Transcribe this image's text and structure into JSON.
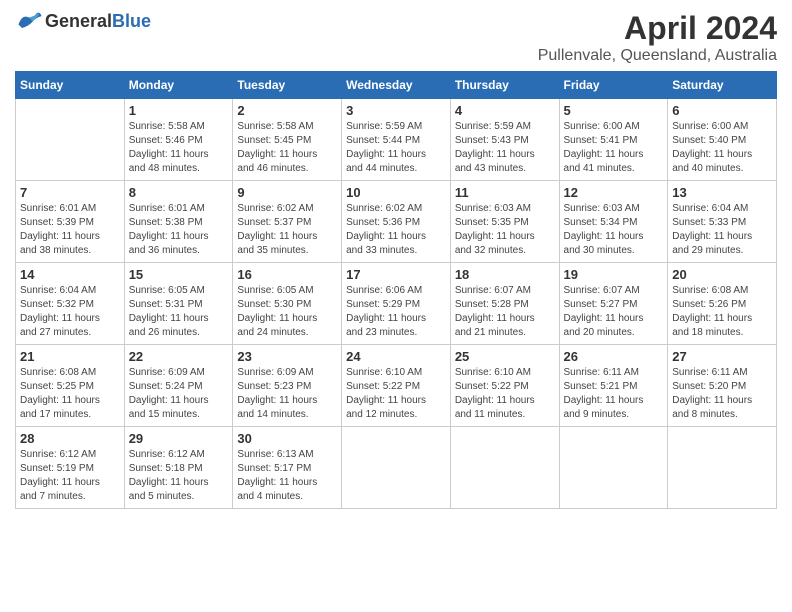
{
  "logo": {
    "general": "General",
    "blue": "Blue"
  },
  "title": "April 2024",
  "location": "Pullenvale, Queensland, Australia",
  "days_of_week": [
    "Sunday",
    "Monday",
    "Tuesday",
    "Wednesday",
    "Thursday",
    "Friday",
    "Saturday"
  ],
  "weeks": [
    [
      {
        "day": "",
        "info": ""
      },
      {
        "day": "1",
        "info": "Sunrise: 5:58 AM\nSunset: 5:46 PM\nDaylight: 11 hours\nand 48 minutes."
      },
      {
        "day": "2",
        "info": "Sunrise: 5:58 AM\nSunset: 5:45 PM\nDaylight: 11 hours\nand 46 minutes."
      },
      {
        "day": "3",
        "info": "Sunrise: 5:59 AM\nSunset: 5:44 PM\nDaylight: 11 hours\nand 44 minutes."
      },
      {
        "day": "4",
        "info": "Sunrise: 5:59 AM\nSunset: 5:43 PM\nDaylight: 11 hours\nand 43 minutes."
      },
      {
        "day": "5",
        "info": "Sunrise: 6:00 AM\nSunset: 5:41 PM\nDaylight: 11 hours\nand 41 minutes."
      },
      {
        "day": "6",
        "info": "Sunrise: 6:00 AM\nSunset: 5:40 PM\nDaylight: 11 hours\nand 40 minutes."
      }
    ],
    [
      {
        "day": "7",
        "info": "Sunrise: 6:01 AM\nSunset: 5:39 PM\nDaylight: 11 hours\nand 38 minutes."
      },
      {
        "day": "8",
        "info": "Sunrise: 6:01 AM\nSunset: 5:38 PM\nDaylight: 11 hours\nand 36 minutes."
      },
      {
        "day": "9",
        "info": "Sunrise: 6:02 AM\nSunset: 5:37 PM\nDaylight: 11 hours\nand 35 minutes."
      },
      {
        "day": "10",
        "info": "Sunrise: 6:02 AM\nSunset: 5:36 PM\nDaylight: 11 hours\nand 33 minutes."
      },
      {
        "day": "11",
        "info": "Sunrise: 6:03 AM\nSunset: 5:35 PM\nDaylight: 11 hours\nand 32 minutes."
      },
      {
        "day": "12",
        "info": "Sunrise: 6:03 AM\nSunset: 5:34 PM\nDaylight: 11 hours\nand 30 minutes."
      },
      {
        "day": "13",
        "info": "Sunrise: 6:04 AM\nSunset: 5:33 PM\nDaylight: 11 hours\nand 29 minutes."
      }
    ],
    [
      {
        "day": "14",
        "info": "Sunrise: 6:04 AM\nSunset: 5:32 PM\nDaylight: 11 hours\nand 27 minutes."
      },
      {
        "day": "15",
        "info": "Sunrise: 6:05 AM\nSunset: 5:31 PM\nDaylight: 11 hours\nand 26 minutes."
      },
      {
        "day": "16",
        "info": "Sunrise: 6:05 AM\nSunset: 5:30 PM\nDaylight: 11 hours\nand 24 minutes."
      },
      {
        "day": "17",
        "info": "Sunrise: 6:06 AM\nSunset: 5:29 PM\nDaylight: 11 hours\nand 23 minutes."
      },
      {
        "day": "18",
        "info": "Sunrise: 6:07 AM\nSunset: 5:28 PM\nDaylight: 11 hours\nand 21 minutes."
      },
      {
        "day": "19",
        "info": "Sunrise: 6:07 AM\nSunset: 5:27 PM\nDaylight: 11 hours\nand 20 minutes."
      },
      {
        "day": "20",
        "info": "Sunrise: 6:08 AM\nSunset: 5:26 PM\nDaylight: 11 hours\nand 18 minutes."
      }
    ],
    [
      {
        "day": "21",
        "info": "Sunrise: 6:08 AM\nSunset: 5:25 PM\nDaylight: 11 hours\nand 17 minutes."
      },
      {
        "day": "22",
        "info": "Sunrise: 6:09 AM\nSunset: 5:24 PM\nDaylight: 11 hours\nand 15 minutes."
      },
      {
        "day": "23",
        "info": "Sunrise: 6:09 AM\nSunset: 5:23 PM\nDaylight: 11 hours\nand 14 minutes."
      },
      {
        "day": "24",
        "info": "Sunrise: 6:10 AM\nSunset: 5:22 PM\nDaylight: 11 hours\nand 12 minutes."
      },
      {
        "day": "25",
        "info": "Sunrise: 6:10 AM\nSunset: 5:22 PM\nDaylight: 11 hours\nand 11 minutes."
      },
      {
        "day": "26",
        "info": "Sunrise: 6:11 AM\nSunset: 5:21 PM\nDaylight: 11 hours\nand 9 minutes."
      },
      {
        "day": "27",
        "info": "Sunrise: 6:11 AM\nSunset: 5:20 PM\nDaylight: 11 hours\nand 8 minutes."
      }
    ],
    [
      {
        "day": "28",
        "info": "Sunrise: 6:12 AM\nSunset: 5:19 PM\nDaylight: 11 hours\nand 7 minutes."
      },
      {
        "day": "29",
        "info": "Sunrise: 6:12 AM\nSunset: 5:18 PM\nDaylight: 11 hours\nand 5 minutes."
      },
      {
        "day": "30",
        "info": "Sunrise: 6:13 AM\nSunset: 5:17 PM\nDaylight: 11 hours\nand 4 minutes."
      },
      {
        "day": "",
        "info": ""
      },
      {
        "day": "",
        "info": ""
      },
      {
        "day": "",
        "info": ""
      },
      {
        "day": "",
        "info": ""
      }
    ]
  ]
}
